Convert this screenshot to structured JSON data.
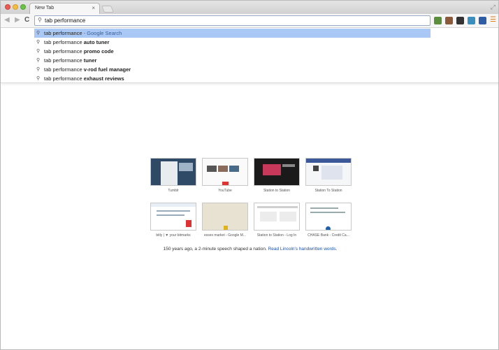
{
  "tab": {
    "title": "New Tab",
    "close": "×"
  },
  "toolbar": {
    "back": "◀",
    "forward": "▶",
    "reload": "C",
    "search_glyph": "⚲"
  },
  "omnibox": {
    "value": "tab performance"
  },
  "suggestions": [
    {
      "prefix": "tab performance",
      "bold": "",
      "suffix": " - Google Search",
      "selected": true
    },
    {
      "prefix": "tab performance ",
      "bold": "auto tuner",
      "suffix": "",
      "selected": false
    },
    {
      "prefix": "tab performance ",
      "bold": "promo code",
      "suffix": "",
      "selected": false
    },
    {
      "prefix": "tab performance ",
      "bold": "tuner",
      "suffix": "",
      "selected": false
    },
    {
      "prefix": "tab performance ",
      "bold": "v-rod fuel manager",
      "suffix": "",
      "selected": false
    },
    {
      "prefix": "tab performance ",
      "bold": "exhaust reviews",
      "suffix": "",
      "selected": false
    }
  ],
  "most_visited": [
    {
      "label": "Tumblr",
      "theme": "tumblr"
    },
    {
      "label": "YouTube",
      "theme": "youtube"
    },
    {
      "label": "Station to Station",
      "theme": "dark"
    },
    {
      "label": "Station To Station",
      "theme": "facebook"
    },
    {
      "label": "bitly | ▼ your bitmarks",
      "theme": "bitly"
    },
    {
      "label": "essex market - Google M...",
      "theme": "maps"
    },
    {
      "label": "Station to Station - Log In",
      "theme": "plain"
    },
    {
      "label": "CHASE Bank - Credit Ca...",
      "theme": "chase"
    }
  ],
  "footer": {
    "text": "150 years ago, a 2-minute speech shaped a nation. ",
    "link": "Read Lincoln's handwritten words."
  },
  "colors": {
    "selection": "#a9c8f5",
    "link": "#1a4fb0",
    "menu_accent": "#e07b1a"
  },
  "icons": {
    "extensions": [
      "puzzle-icon",
      "avatar-icon",
      "graduation-cap-icon",
      "download-icon",
      "bookmark-icon"
    ],
    "menu": "hamburger-menu-icon"
  }
}
